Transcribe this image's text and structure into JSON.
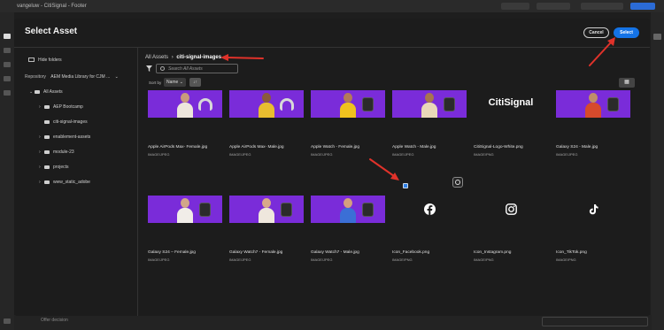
{
  "topbar": {
    "title": "vangeluw - CitiSignal - Footer"
  },
  "modal": {
    "title": "Select Asset",
    "cancel_label": "Cancel",
    "select_label": "Select"
  },
  "sidebar": {
    "hide_folders_label": "Hide folders",
    "repository_label": "Repository",
    "repository_value": "AEM Media Library for CJM ...",
    "all_assets_label": "All Assets",
    "folders": [
      "AEP Bootcamp",
      "citi-signal-images",
      "enablement-assets",
      "module-23",
      "projects",
      "www_static_adobe"
    ]
  },
  "breadcrumb": {
    "root": "All Assets",
    "separator": "›",
    "current": "citi-signal-images"
  },
  "search": {
    "placeholder": "Search All Assets"
  },
  "sort": {
    "label": "Sort by",
    "value": "Name",
    "direction": "↓↑"
  },
  "assets": [
    {
      "name": "Apple AirPods Max- Female.jpg",
      "type": "IMAGE/JPEG"
    },
    {
      "name": "Apple AirPods Max- Male.jpg",
      "type": "IMAGE/JPEG"
    },
    {
      "name": "Apple Watch - Female.jpg",
      "type": "IMAGE/JPEG"
    },
    {
      "name": "Apple Watch - Male.jpg",
      "type": "IMAGE/JPEG"
    },
    {
      "name": "CitiSignal-Logo-White.png",
      "type": "IMAGE/PNG",
      "logo_text": "CitiSignal"
    },
    {
      "name": "Galaxy S24 - Male.jpg",
      "type": "IMAGE/JPEG"
    },
    {
      "name": "Galaxy S24 – Female.jpg",
      "type": "IMAGE/JPEG"
    },
    {
      "name": "Galaxy Watch7 - Female.jpg",
      "type": "IMAGE/JPEG"
    },
    {
      "name": "Galaxy Watch7 - Male.jpg",
      "type": "IMAGE/JPEG"
    },
    {
      "name": "Icon_Facebook.png",
      "type": "IMAGE/PNG"
    },
    {
      "name": "Icon_Instagram.png",
      "type": "IMAGE/PNG"
    },
    {
      "name": "Icon_TikTok.png",
      "type": "IMAGE/PNG"
    }
  ],
  "bottombar": {
    "offer_placeholder": "Offer decision"
  },
  "colors": {
    "accent": "#1473e6",
    "thumb_purple": "#7a2cd9",
    "annotation_red": "#e0322a"
  }
}
